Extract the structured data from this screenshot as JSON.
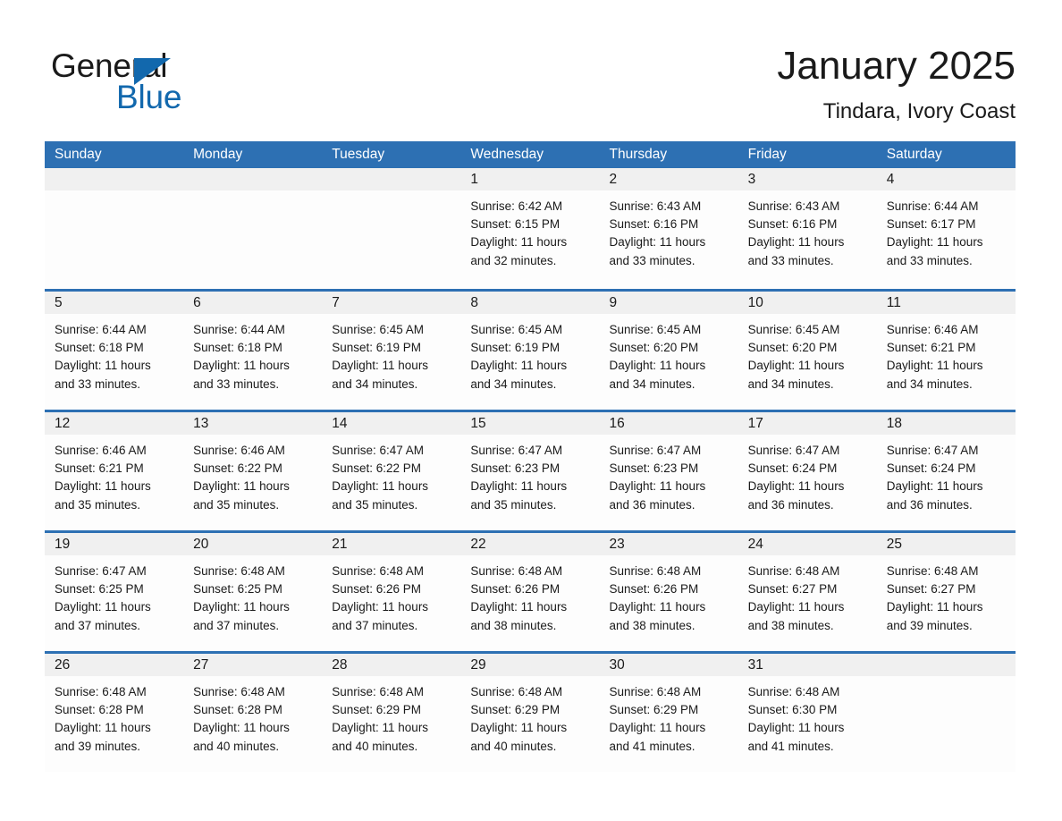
{
  "brand": {
    "name_part1": "General",
    "name_part2": "Blue",
    "accent_color": "#1268ad",
    "triangle_icon": "triangle-icon"
  },
  "header": {
    "month_title": "January 2025",
    "location": "Tindara, Ivory Coast"
  },
  "theme": {
    "header_blue": "#2d70b3",
    "daynum_band": "#f0f0f0",
    "text": "#1a1a1a"
  },
  "weekday_headers": [
    "Sunday",
    "Monday",
    "Tuesday",
    "Wednesday",
    "Thursday",
    "Friday",
    "Saturday"
  ],
  "weeks": [
    [
      {
        "day": "",
        "sunrise": "",
        "sunset": "",
        "daylight_line1": "",
        "daylight_line2": "",
        "empty": true
      },
      {
        "day": "",
        "sunrise": "",
        "sunset": "",
        "daylight_line1": "",
        "daylight_line2": "",
        "empty": true
      },
      {
        "day": "",
        "sunrise": "",
        "sunset": "",
        "daylight_line1": "",
        "daylight_line2": "",
        "empty": true
      },
      {
        "day": "1",
        "sunrise": "Sunrise: 6:42 AM",
        "sunset": "Sunset: 6:15 PM",
        "daylight_line1": "Daylight: 11 hours",
        "daylight_line2": "and 32 minutes."
      },
      {
        "day": "2",
        "sunrise": "Sunrise: 6:43 AM",
        "sunset": "Sunset: 6:16 PM",
        "daylight_line1": "Daylight: 11 hours",
        "daylight_line2": "and 33 minutes."
      },
      {
        "day": "3",
        "sunrise": "Sunrise: 6:43 AM",
        "sunset": "Sunset: 6:16 PM",
        "daylight_line1": "Daylight: 11 hours",
        "daylight_line2": "and 33 minutes."
      },
      {
        "day": "4",
        "sunrise": "Sunrise: 6:44 AM",
        "sunset": "Sunset: 6:17 PM",
        "daylight_line1": "Daylight: 11 hours",
        "daylight_line2": "and 33 minutes."
      }
    ],
    [
      {
        "day": "5",
        "sunrise": "Sunrise: 6:44 AM",
        "sunset": "Sunset: 6:18 PM",
        "daylight_line1": "Daylight: 11 hours",
        "daylight_line2": "and 33 minutes."
      },
      {
        "day": "6",
        "sunrise": "Sunrise: 6:44 AM",
        "sunset": "Sunset: 6:18 PM",
        "daylight_line1": "Daylight: 11 hours",
        "daylight_line2": "and 33 minutes."
      },
      {
        "day": "7",
        "sunrise": "Sunrise: 6:45 AM",
        "sunset": "Sunset: 6:19 PM",
        "daylight_line1": "Daylight: 11 hours",
        "daylight_line2": "and 34 minutes."
      },
      {
        "day": "8",
        "sunrise": "Sunrise: 6:45 AM",
        "sunset": "Sunset: 6:19 PM",
        "daylight_line1": "Daylight: 11 hours",
        "daylight_line2": "and 34 minutes."
      },
      {
        "day": "9",
        "sunrise": "Sunrise: 6:45 AM",
        "sunset": "Sunset: 6:20 PM",
        "daylight_line1": "Daylight: 11 hours",
        "daylight_line2": "and 34 minutes."
      },
      {
        "day": "10",
        "sunrise": "Sunrise: 6:45 AM",
        "sunset": "Sunset: 6:20 PM",
        "daylight_line1": "Daylight: 11 hours",
        "daylight_line2": "and 34 minutes."
      },
      {
        "day": "11",
        "sunrise": "Sunrise: 6:46 AM",
        "sunset": "Sunset: 6:21 PM",
        "daylight_line1": "Daylight: 11 hours",
        "daylight_line2": "and 34 minutes."
      }
    ],
    [
      {
        "day": "12",
        "sunrise": "Sunrise: 6:46 AM",
        "sunset": "Sunset: 6:21 PM",
        "daylight_line1": "Daylight: 11 hours",
        "daylight_line2": "and 35 minutes."
      },
      {
        "day": "13",
        "sunrise": "Sunrise: 6:46 AM",
        "sunset": "Sunset: 6:22 PM",
        "daylight_line1": "Daylight: 11 hours",
        "daylight_line2": "and 35 minutes."
      },
      {
        "day": "14",
        "sunrise": "Sunrise: 6:47 AM",
        "sunset": "Sunset: 6:22 PM",
        "daylight_line1": "Daylight: 11 hours",
        "daylight_line2": "and 35 minutes."
      },
      {
        "day": "15",
        "sunrise": "Sunrise: 6:47 AM",
        "sunset": "Sunset: 6:23 PM",
        "daylight_line1": "Daylight: 11 hours",
        "daylight_line2": "and 35 minutes."
      },
      {
        "day": "16",
        "sunrise": "Sunrise: 6:47 AM",
        "sunset": "Sunset: 6:23 PM",
        "daylight_line1": "Daylight: 11 hours",
        "daylight_line2": "and 36 minutes."
      },
      {
        "day": "17",
        "sunrise": "Sunrise: 6:47 AM",
        "sunset": "Sunset: 6:24 PM",
        "daylight_line1": "Daylight: 11 hours",
        "daylight_line2": "and 36 minutes."
      },
      {
        "day": "18",
        "sunrise": "Sunrise: 6:47 AM",
        "sunset": "Sunset: 6:24 PM",
        "daylight_line1": "Daylight: 11 hours",
        "daylight_line2": "and 36 minutes."
      }
    ],
    [
      {
        "day": "19",
        "sunrise": "Sunrise: 6:47 AM",
        "sunset": "Sunset: 6:25 PM",
        "daylight_line1": "Daylight: 11 hours",
        "daylight_line2": "and 37 minutes."
      },
      {
        "day": "20",
        "sunrise": "Sunrise: 6:48 AM",
        "sunset": "Sunset: 6:25 PM",
        "daylight_line1": "Daylight: 11 hours",
        "daylight_line2": "and 37 minutes."
      },
      {
        "day": "21",
        "sunrise": "Sunrise: 6:48 AM",
        "sunset": "Sunset: 6:26 PM",
        "daylight_line1": "Daylight: 11 hours",
        "daylight_line2": "and 37 minutes."
      },
      {
        "day": "22",
        "sunrise": "Sunrise: 6:48 AM",
        "sunset": "Sunset: 6:26 PM",
        "daylight_line1": "Daylight: 11 hours",
        "daylight_line2": "and 38 minutes."
      },
      {
        "day": "23",
        "sunrise": "Sunrise: 6:48 AM",
        "sunset": "Sunset: 6:26 PM",
        "daylight_line1": "Daylight: 11 hours",
        "daylight_line2": "and 38 minutes."
      },
      {
        "day": "24",
        "sunrise": "Sunrise: 6:48 AM",
        "sunset": "Sunset: 6:27 PM",
        "daylight_line1": "Daylight: 11 hours",
        "daylight_line2": "and 38 minutes."
      },
      {
        "day": "25",
        "sunrise": "Sunrise: 6:48 AM",
        "sunset": "Sunset: 6:27 PM",
        "daylight_line1": "Daylight: 11 hours",
        "daylight_line2": "and 39 minutes."
      }
    ],
    [
      {
        "day": "26",
        "sunrise": "Sunrise: 6:48 AM",
        "sunset": "Sunset: 6:28 PM",
        "daylight_line1": "Daylight: 11 hours",
        "daylight_line2": "and 39 minutes."
      },
      {
        "day": "27",
        "sunrise": "Sunrise: 6:48 AM",
        "sunset": "Sunset: 6:28 PM",
        "daylight_line1": "Daylight: 11 hours",
        "daylight_line2": "and 40 minutes."
      },
      {
        "day": "28",
        "sunrise": "Sunrise: 6:48 AM",
        "sunset": "Sunset: 6:29 PM",
        "daylight_line1": "Daylight: 11 hours",
        "daylight_line2": "and 40 minutes."
      },
      {
        "day": "29",
        "sunrise": "Sunrise: 6:48 AM",
        "sunset": "Sunset: 6:29 PM",
        "daylight_line1": "Daylight: 11 hours",
        "daylight_line2": "and 40 minutes."
      },
      {
        "day": "30",
        "sunrise": "Sunrise: 6:48 AM",
        "sunset": "Sunset: 6:29 PM",
        "daylight_line1": "Daylight: 11 hours",
        "daylight_line2": "and 41 minutes."
      },
      {
        "day": "31",
        "sunrise": "Sunrise: 6:48 AM",
        "sunset": "Sunset: 6:30 PM",
        "daylight_line1": "Daylight: 11 hours",
        "daylight_line2": "and 41 minutes."
      },
      {
        "day": "",
        "sunrise": "",
        "sunset": "",
        "daylight_line1": "",
        "daylight_line2": "",
        "empty": true
      }
    ]
  ]
}
